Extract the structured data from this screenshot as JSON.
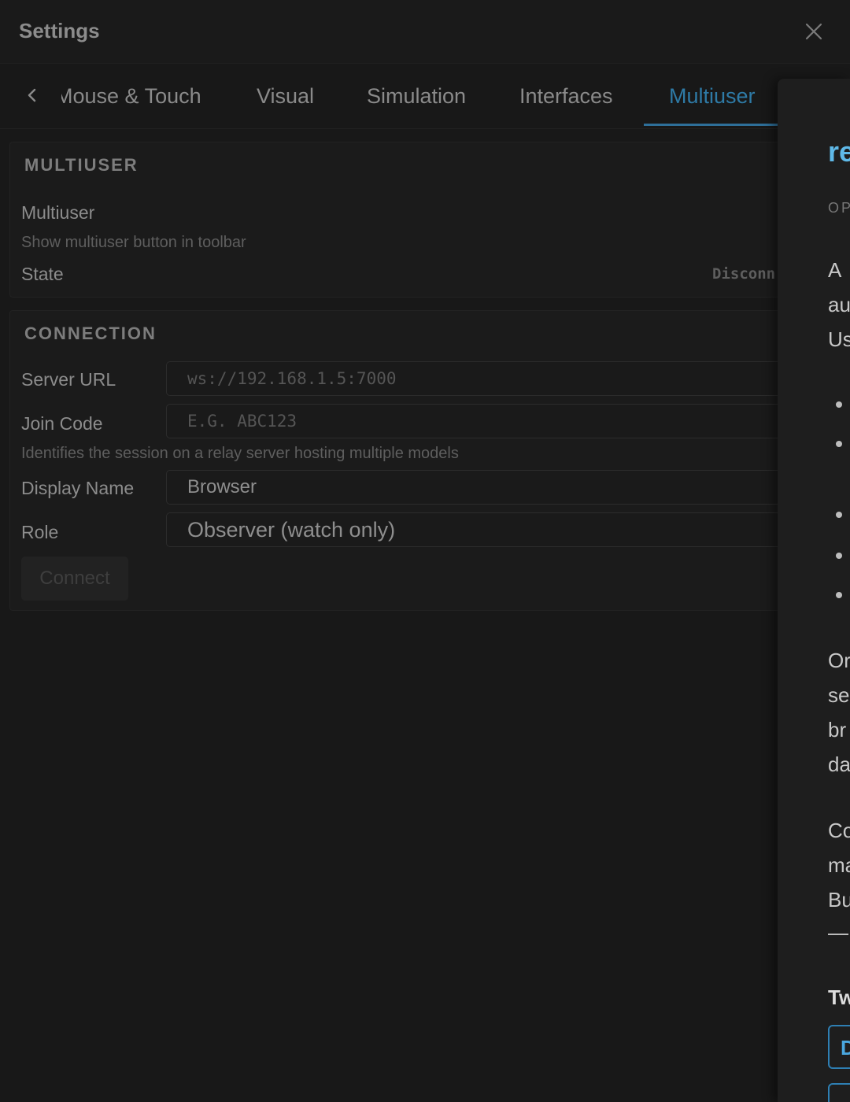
{
  "header": {
    "title": "Settings"
  },
  "tabs": [
    {
      "label": "Mouse & Touch",
      "active": false
    },
    {
      "label": "Visual",
      "active": false
    },
    {
      "label": "Simulation",
      "active": false
    },
    {
      "label": "Interfaces",
      "active": false
    },
    {
      "label": "Multiuser",
      "active": true
    }
  ],
  "multiuser": {
    "section_title": "MULTIUSER",
    "toggle_label": "Multiuser",
    "toggle_hint": "Show multiuser button in toolbar",
    "state_label": "State",
    "state_value": "Disconn"
  },
  "connection": {
    "section_title": "CONNECTION",
    "server_url_label": "Server URL",
    "server_url_placeholder": "ws://192.168.1.5:7000",
    "join_code_label": "Join Code",
    "join_code_placeholder": "E.G. ABC123",
    "join_code_hint": "Identifies the session on a relay server hosting multiple models",
    "display_name_label": "Display Name",
    "display_name_value": "Browser",
    "role_label": "Role",
    "role_value": "Observer (watch only)",
    "connect_label": "Connect"
  },
  "side_panel": {
    "title": "re",
    "subtitle": "OP",
    "para1": [
      "A",
      "au",
      "Us"
    ],
    "para2": [
      "Or",
      "se",
      "br",
      "da"
    ],
    "para3": [
      "Co",
      "ma",
      "Bu"
    ],
    "heading": "Tw",
    "box_label": "D"
  },
  "colors": {
    "accent": "#2e7aa6",
    "panel_title": "#5fb9e8",
    "background": "#181818"
  }
}
